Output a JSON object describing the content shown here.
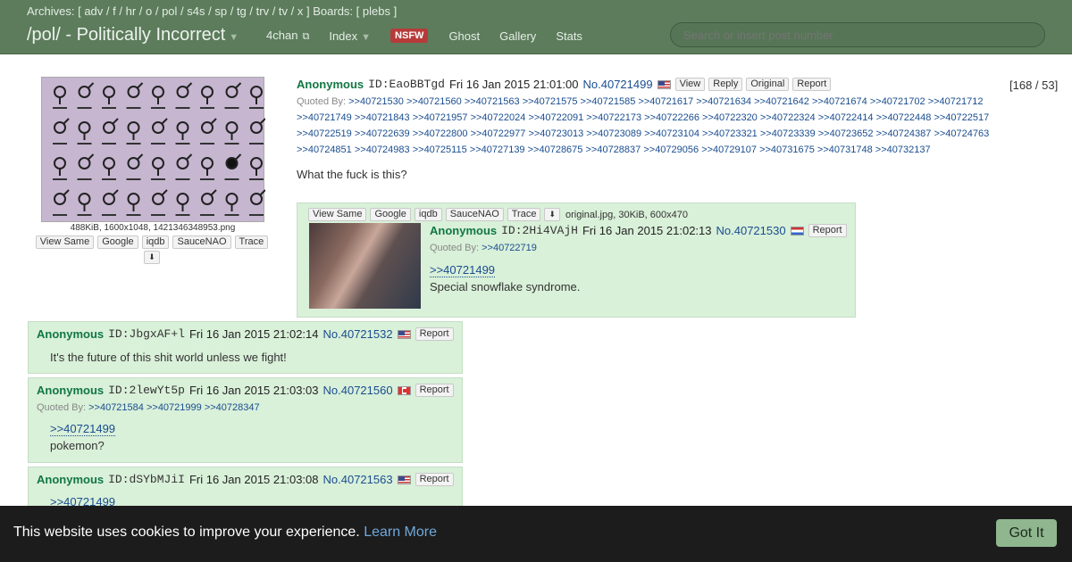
{
  "topbar": {
    "archives_label": "Archives: [",
    "archives": [
      "adv",
      "f",
      "hr",
      "o",
      "pol",
      "s4s",
      "sp",
      "tg",
      "trv",
      "tv",
      "x"
    ],
    "boards_label": "] Boards: [",
    "boards": [
      "plebs"
    ],
    "boards_close": "]",
    "board_title": "/pol/ - Politically Incorrect",
    "nav": {
      "fourchan": "4chan",
      "index": "Index",
      "nsfw": "NSFW",
      "ghost": "Ghost",
      "gallery": "Gallery",
      "stats": "Stats"
    },
    "search_placeholder": "Search or insert post number"
  },
  "op": {
    "image_fileinfo": "488KiB, 1600x1048, 1421346348953.png",
    "tools": [
      "View Same",
      "Google",
      "iqdb",
      "SauceNAO",
      "Trace"
    ],
    "name": "Anonymous",
    "id": "ID:EaoBBTgd",
    "date": "Fri 16 Jan 2015 21:01:00",
    "no": "No.40721499",
    "flag": "us",
    "buttons": [
      "View",
      "Reply",
      "Original",
      "Report"
    ],
    "page_count": "[168 / 53]",
    "quoted_by_label": "Quoted By:",
    "quoted_by": [
      ">>40721530",
      ">>40721560",
      ">>40721563",
      ">>40721575",
      ">>40721585",
      ">>40721617",
      ">>40721634",
      ">>40721642",
      ">>40721674",
      ">>40721702",
      ">>40721712",
      ">>40721749",
      ">>40721843",
      ">>40721957",
      ">>40722024",
      ">>40722091",
      ">>40722173",
      ">>40722266",
      ">>40722320",
      ">>40722324",
      ">>40722414",
      ">>40722448",
      ">>40722517",
      ">>40722519",
      ">>40722639",
      ">>40722800",
      ">>40722977",
      ">>40723013",
      ">>40723089",
      ">>40723104",
      ">>40723321",
      ">>40723339",
      ">>40723652",
      ">>40724387",
      ">>40724763",
      ">>40724851",
      ">>40724983",
      ">>40725115",
      ">>40727139",
      ">>40728675",
      ">>40728837",
      ">>40729056",
      ">>40729107",
      ">>40731675",
      ">>40731748",
      ">>40732137"
    ],
    "comment": "What the fuck is this?"
  },
  "inline_post": {
    "tools": [
      "View Same",
      "Google",
      "iqdb",
      "SauceNAO",
      "Trace"
    ],
    "fileinfo": "original.jpg, 30KiB, 600x470",
    "name": "Anonymous",
    "id": "ID:2Hi4VAjH",
    "date": "Fri 16 Jan 2015 21:02:13",
    "no": "No.40721530",
    "flag": "nl",
    "report": "Report",
    "quoted_by_label": "Quoted By:",
    "quoted_by": [
      ">>40722719"
    ],
    "ref": ">>40721499",
    "comment": "Special snowflake syndrome."
  },
  "replies": [
    {
      "name": "Anonymous",
      "id": "ID:JbgxAF+l",
      "date": "Fri 16 Jan 2015 21:02:14",
      "no": "No.40721532",
      "flag": "us",
      "report": "Report",
      "comment": "It's the future of this shit world unless we fight!"
    },
    {
      "name": "Anonymous",
      "id": "ID:2lewYt5p",
      "date": "Fri 16 Jan 2015 21:03:03",
      "no": "No.40721560",
      "flag": "ca",
      "report": "Report",
      "quoted_by_label": "Quoted By:",
      "quoted_by": [
        ">>40721584",
        ">>40721999",
        ">>40728347"
      ],
      "ref": ">>40721499",
      "comment": "pokemon?"
    },
    {
      "name": "Anonymous",
      "id": "ID:dSYbMJiI",
      "date": "Fri 16 Jan 2015 21:03:08",
      "no": "No.40721563",
      "flag": "us",
      "report": "Report",
      "ref": ">>40721499"
    }
  ],
  "cookie": {
    "message": "This website uses cookies to improve your experience.",
    "learn_more": "Learn More",
    "button": "Got It"
  }
}
